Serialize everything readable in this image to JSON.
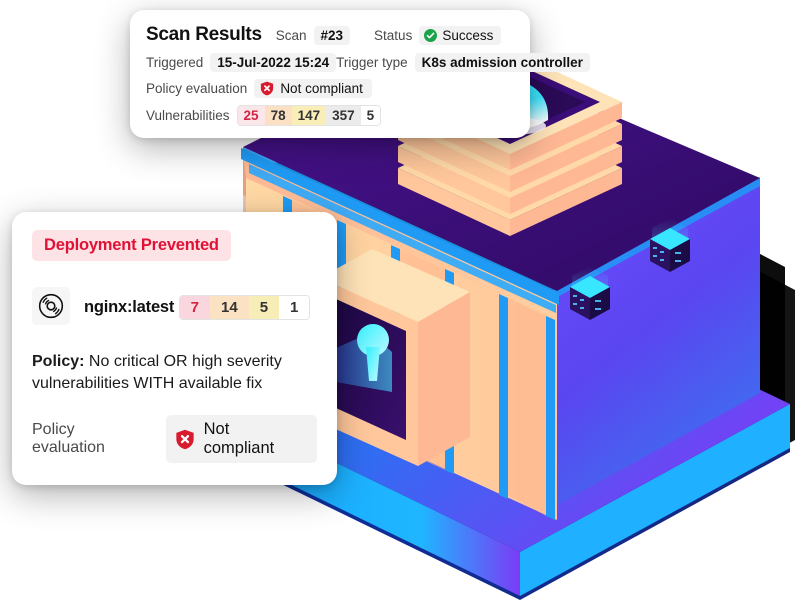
{
  "scan_card": {
    "title": "Scan Results",
    "scan_label": "Scan",
    "scan_number": "#23",
    "status_label": "Status",
    "status_value": "Success",
    "status_icon": "check-circle-icon",
    "triggered_label": "Triggered",
    "triggered_value": "15-Jul-2022 15:24",
    "trigger_type_label": "Trigger type",
    "trigger_type_value": "K8s admission controller",
    "policy_eval_label": "Policy evaluation",
    "policy_eval_value": "Not compliant",
    "policy_eval_icon": "shield-x-icon",
    "vulnerabilities_label": "Vulnerabilities",
    "vulnerabilities": [
      {
        "count": "25",
        "severity": "critical",
        "bg": "#fbe6ea",
        "fg": "#d32441"
      },
      {
        "count": "78",
        "severity": "high",
        "bg": "#fbe0c4",
        "fg": "#333333"
      },
      {
        "count": "147",
        "severity": "medium",
        "bg": "#faeeb8",
        "fg": "#333333"
      },
      {
        "count": "357",
        "severity": "low",
        "bg": "#ebebeb",
        "fg": "#333333"
      },
      {
        "count": "5",
        "severity": "negligible",
        "bg": "#ffffff",
        "fg": "#333333"
      }
    ]
  },
  "deploy_card": {
    "status_badge": "Deployment Prevented",
    "image_icon": "container-disc-icon",
    "image_name": "nginx:latest",
    "image_vulnerabilities": [
      {
        "count": "7",
        "severity": "critical",
        "bg": "#fad7de",
        "fg": "#d32441"
      },
      {
        "count": "14",
        "severity": "high",
        "bg": "#fae2c2",
        "fg": "#333333"
      },
      {
        "count": "5",
        "severity": "medium",
        "bg": "#f7edb6",
        "fg": "#333333"
      },
      {
        "count": "1",
        "severity": "low",
        "bg": "#ffffff",
        "fg": "#333333"
      }
    ],
    "policy_prefix": "Policy:",
    "policy_body": " No critical OR high severity vulnerabilities WITH available fix",
    "eval_label": "Policy evaluation",
    "eval_value": "Not compliant",
    "eval_icon": "shield-x-icon"
  },
  "illustration": {
    "name": "isometric-secure-vault-illustration",
    "colors": {
      "peach": "#ffc79b",
      "peach_light": "#ffd9a8",
      "peach_pale": "#ffe3b8",
      "blue_accent": "#1f9bf5",
      "purple_deep": "#3d0f7a",
      "purple_dark": "#2b0a57",
      "indigo": "#4b36e8",
      "cyan": "#25e0f5",
      "base_blue": "#1462e8"
    }
  }
}
